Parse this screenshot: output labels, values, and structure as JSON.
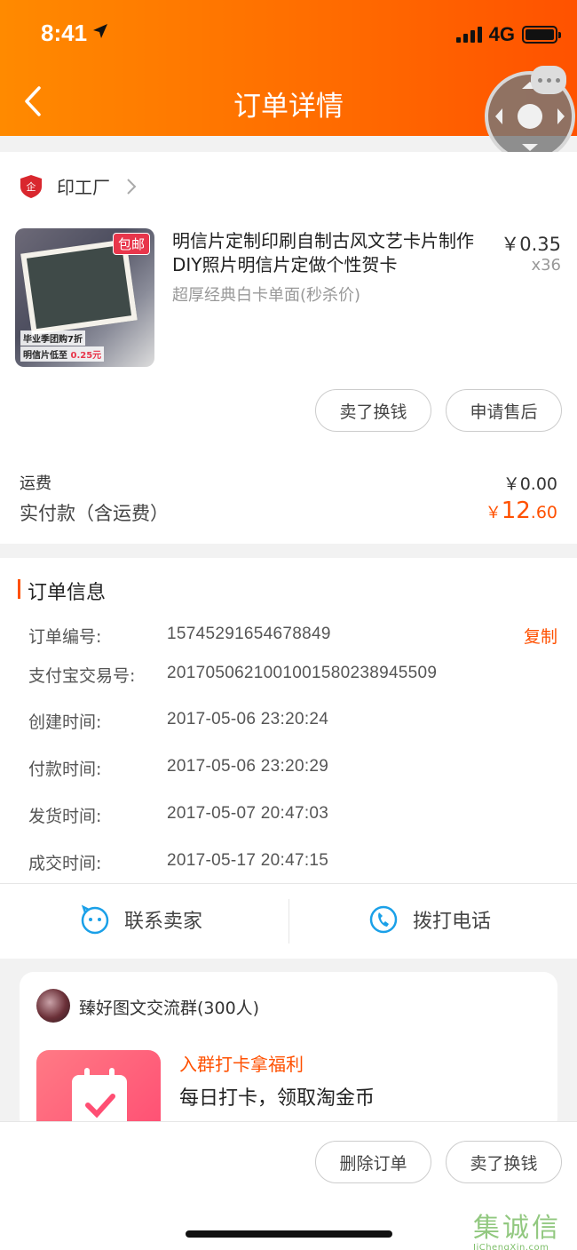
{
  "status_bar": {
    "time": "8:41",
    "network": "4G"
  },
  "header": {
    "title": "订单详情"
  },
  "shop": {
    "name": "印工厂"
  },
  "product": {
    "title": "明信片定制印刷自制古风文艺卡片制作DIY照片明信片定做个性贺卡",
    "spec": "超厚经典白卡单面(秒杀价)",
    "price": "￥0.35",
    "quantity": "x36",
    "badge": "包邮",
    "promo_line1": "毕业季团购7折",
    "promo_line2_prefix": "明信片低至",
    "promo_line2_price": "0.25元"
  },
  "item_actions": {
    "sell": "卖了换钱",
    "after_sale": "申请售后"
  },
  "payment": {
    "shipping_label": "运费",
    "shipping_value": "￥0.00",
    "paid_label": "实付款（含运费）",
    "paid_symbol": "￥",
    "paid_int": "12",
    "paid_dec": ".60"
  },
  "order_info": {
    "title": "订单信息",
    "copy": "复制",
    "rows": [
      {
        "label": "订单编号:",
        "value": "15745291654678849"
      },
      {
        "label": "支付宝交易号:",
        "value": "2017050621001001580238945509"
      },
      {
        "label": "创建时间:",
        "value": "2017-05-06 23:20:24"
      },
      {
        "label": "付款时间:",
        "value": "2017-05-06 23:20:29"
      },
      {
        "label": "发货时间:",
        "value": "2017-05-07 20:47:03"
      },
      {
        "label": "成交时间:",
        "value": "2017-05-17 20:47:15"
      }
    ]
  },
  "contact": {
    "seller": "联系卖家",
    "phone": "拨打电话"
  },
  "group": {
    "name": "臻好图文交流群(300人)",
    "promo_title": "入群打卡拿福利",
    "promo_sub": "每日打卡，领取淘金币"
  },
  "bottom_actions": {
    "delete": "删除订单",
    "sell": "卖了换钱"
  },
  "watermark": {
    "chars": [
      "集",
      "诚",
      "信"
    ],
    "url": "JiChengXin.com"
  },
  "colors": {
    "accent": "#ff5000",
    "header_start": "#ff8a00",
    "header_end": "#ff5200",
    "brand_shield": "#d9272e"
  }
}
